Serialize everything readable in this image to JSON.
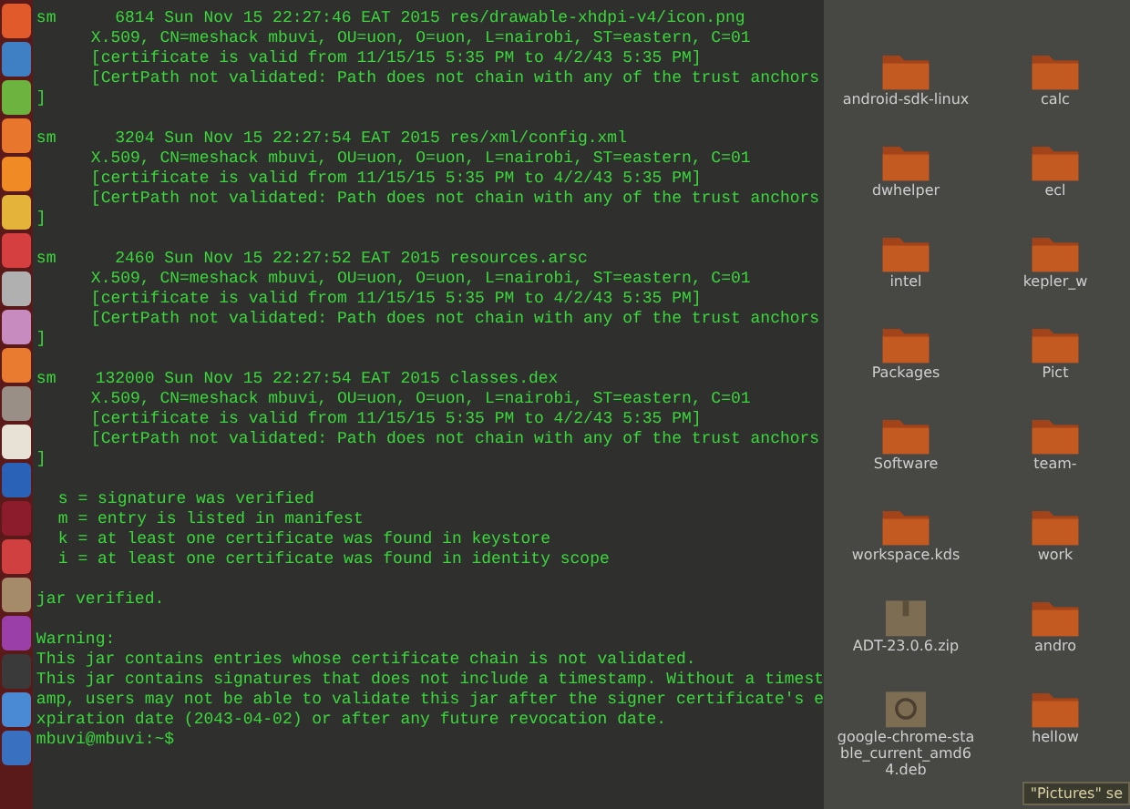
{
  "terminal": {
    "entries": [
      {
        "header": "sm      6814 Sun Nov 15 22:27:46 EAT 2015 res/drawable-xhdpi-v4/icon.png",
        "details": [
          "X.509, CN=meshack mbuvi, OU=uon, O=uon, L=nairobi, ST=eastern, C=01",
          "[certificate is valid from 11/15/15 5:35 PM to 4/2/43 5:35 PM]",
          "[CertPath not validated: Path does not chain with any of the trust anchors"
        ],
        "closing": "]"
      },
      {
        "header": "sm      3204 Sun Nov 15 22:27:54 EAT 2015 res/xml/config.xml",
        "details": [
          "X.509, CN=meshack mbuvi, OU=uon, O=uon, L=nairobi, ST=eastern, C=01",
          "[certificate is valid from 11/15/15 5:35 PM to 4/2/43 5:35 PM]",
          "[CertPath not validated: Path does not chain with any of the trust anchors"
        ],
        "closing": "]"
      },
      {
        "header": "sm      2460 Sun Nov 15 22:27:52 EAT 2015 resources.arsc",
        "details": [
          "X.509, CN=meshack mbuvi, OU=uon, O=uon, L=nairobi, ST=eastern, C=01",
          "[certificate is valid from 11/15/15 5:35 PM to 4/2/43 5:35 PM]",
          "[CertPath not validated: Path does not chain with any of the trust anchors"
        ],
        "closing": "]"
      },
      {
        "header": "sm    132000 Sun Nov 15 22:27:54 EAT 2015 classes.dex",
        "details": [
          "X.509, CN=meshack mbuvi, OU=uon, O=uon, L=nairobi, ST=eastern, C=01",
          "[certificate is valid from 11/15/15 5:35 PM to 4/2/43 5:35 PM]",
          "[CertPath not validated: Path does not chain with any of the trust anchors"
        ],
        "closing": "]"
      }
    ],
    "legend": [
      "s = signature was verified",
      "m = entry is listed in manifest",
      "k = at least one certificate was found in keystore",
      "i = at least one certificate was found in identity scope"
    ],
    "result": "jar verified.",
    "warning": {
      "title": "Warning:",
      "lines": [
        "This jar contains entries whose certificate chain is not validated.",
        "This jar contains signatures that does not include a timestamp. Without a timest",
        "amp, users may not be able to validate this jar after the signer certificate's e",
        "xpiration date (2043-04-02) or after any future revocation date."
      ]
    },
    "prompt": "mbuvi@mbuvi:~$"
  },
  "files": [
    {
      "name": "android-sdk-linux",
      "kind": "folder"
    },
    {
      "name": "calc",
      "kind": "folder"
    },
    {
      "name": "dwhelper",
      "kind": "folder"
    },
    {
      "name": "ecl",
      "kind": "folder"
    },
    {
      "name": "intel",
      "kind": "folder"
    },
    {
      "name": "kepler_w",
      "kind": "folder"
    },
    {
      "name": "Packages",
      "kind": "folder"
    },
    {
      "name": "Pict",
      "kind": "folder"
    },
    {
      "name": "Software",
      "kind": "folder"
    },
    {
      "name": "team-",
      "kind": "folder"
    },
    {
      "name": "workspace.kds",
      "kind": "folder"
    },
    {
      "name": "work",
      "kind": "folder"
    },
    {
      "name": "ADT-23.0.6.zip",
      "kind": "archive"
    },
    {
      "name": "andro",
      "kind": "folder"
    },
    {
      "name": "google-chrome-stable_current_amd64.deb",
      "kind": "package"
    },
    {
      "name": "hellow",
      "kind": "folder"
    }
  ],
  "tooltip": "\"Pictures\" se"
}
